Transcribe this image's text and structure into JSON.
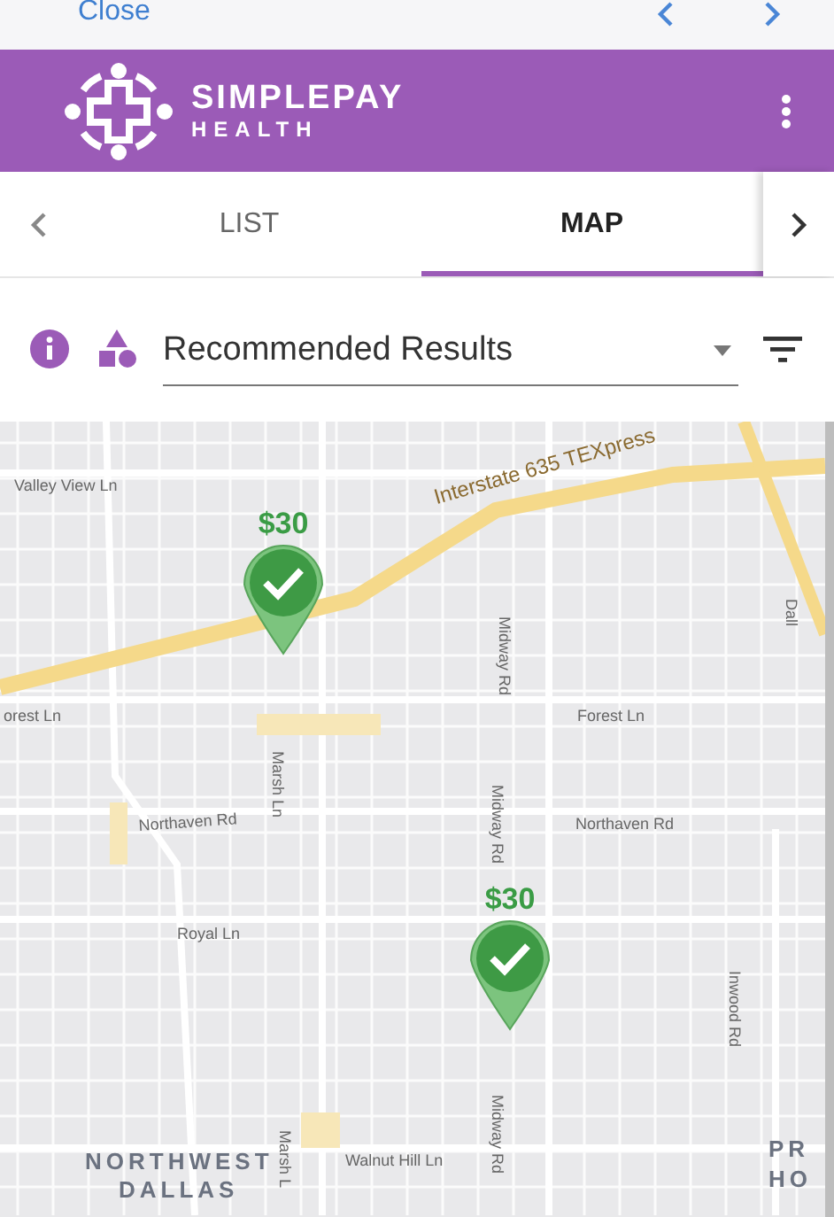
{
  "top_bar": {
    "close": "Close"
  },
  "header": {
    "brand": "SIMPLEPAY",
    "subbrand": "HEALTH"
  },
  "tabs": [
    {
      "label": "LIST",
      "selected": false
    },
    {
      "label": "MAP",
      "selected": true
    }
  ],
  "filter": {
    "sort": "Recommended Results"
  },
  "map": {
    "labels": [
      {
        "text": "Valley View Ln"
      },
      {
        "text": "Interstate 635 TEXpress"
      },
      {
        "text": "Dall"
      },
      {
        "text": "Midway Rd"
      },
      {
        "text": "orest Ln"
      },
      {
        "text": "Forest Ln"
      },
      {
        "text": "Marsh Ln"
      },
      {
        "text": "Northaven Rd"
      },
      {
        "text": "Midway Rd"
      },
      {
        "text": "Northaven Rd"
      },
      {
        "text": "Royal Ln"
      },
      {
        "text": "Inwood Rd"
      },
      {
        "text": "Midway Rd"
      },
      {
        "text": "NORTHWEST"
      },
      {
        "text": "DALLAS"
      },
      {
        "text": "Walnut Hill Ln"
      },
      {
        "text": "Marsh L"
      },
      {
        "text": "PR"
      },
      {
        "text": "HO"
      }
    ],
    "markers": [
      {
        "price": "$30"
      },
      {
        "price": "$30"
      }
    ]
  }
}
